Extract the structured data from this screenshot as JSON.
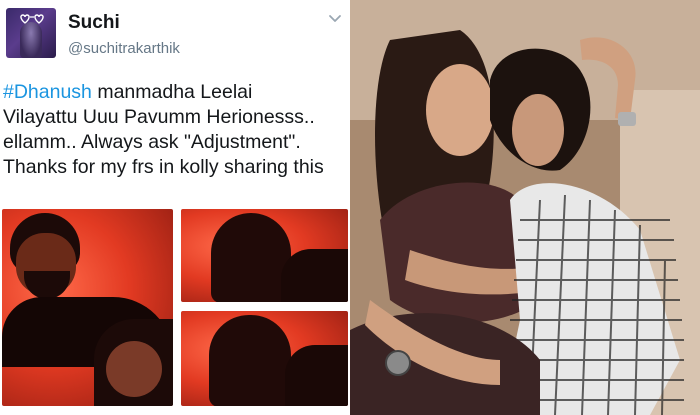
{
  "tweet": {
    "display_name": "Suchi",
    "handle": "@suchitrakarthik",
    "text_lines": [
      {
        "hashtag": "#Dhanush",
        "rest": " manmadha Leelai"
      },
      {
        "text": "Vilayattu Uuu Pavumm Herionesss.."
      },
      {
        "text": "ellamm.. Always ask  \"Adjustment\"."
      },
      {
        "text": "Thanks for my frs in kolly sharing this"
      }
    ]
  },
  "colors": {
    "hashtag": "#1b95e0",
    "name": "#14171a",
    "handle": "#657786",
    "photo_red": "#e23a22"
  },
  "icons": [
    "chevron-down-icon"
  ]
}
